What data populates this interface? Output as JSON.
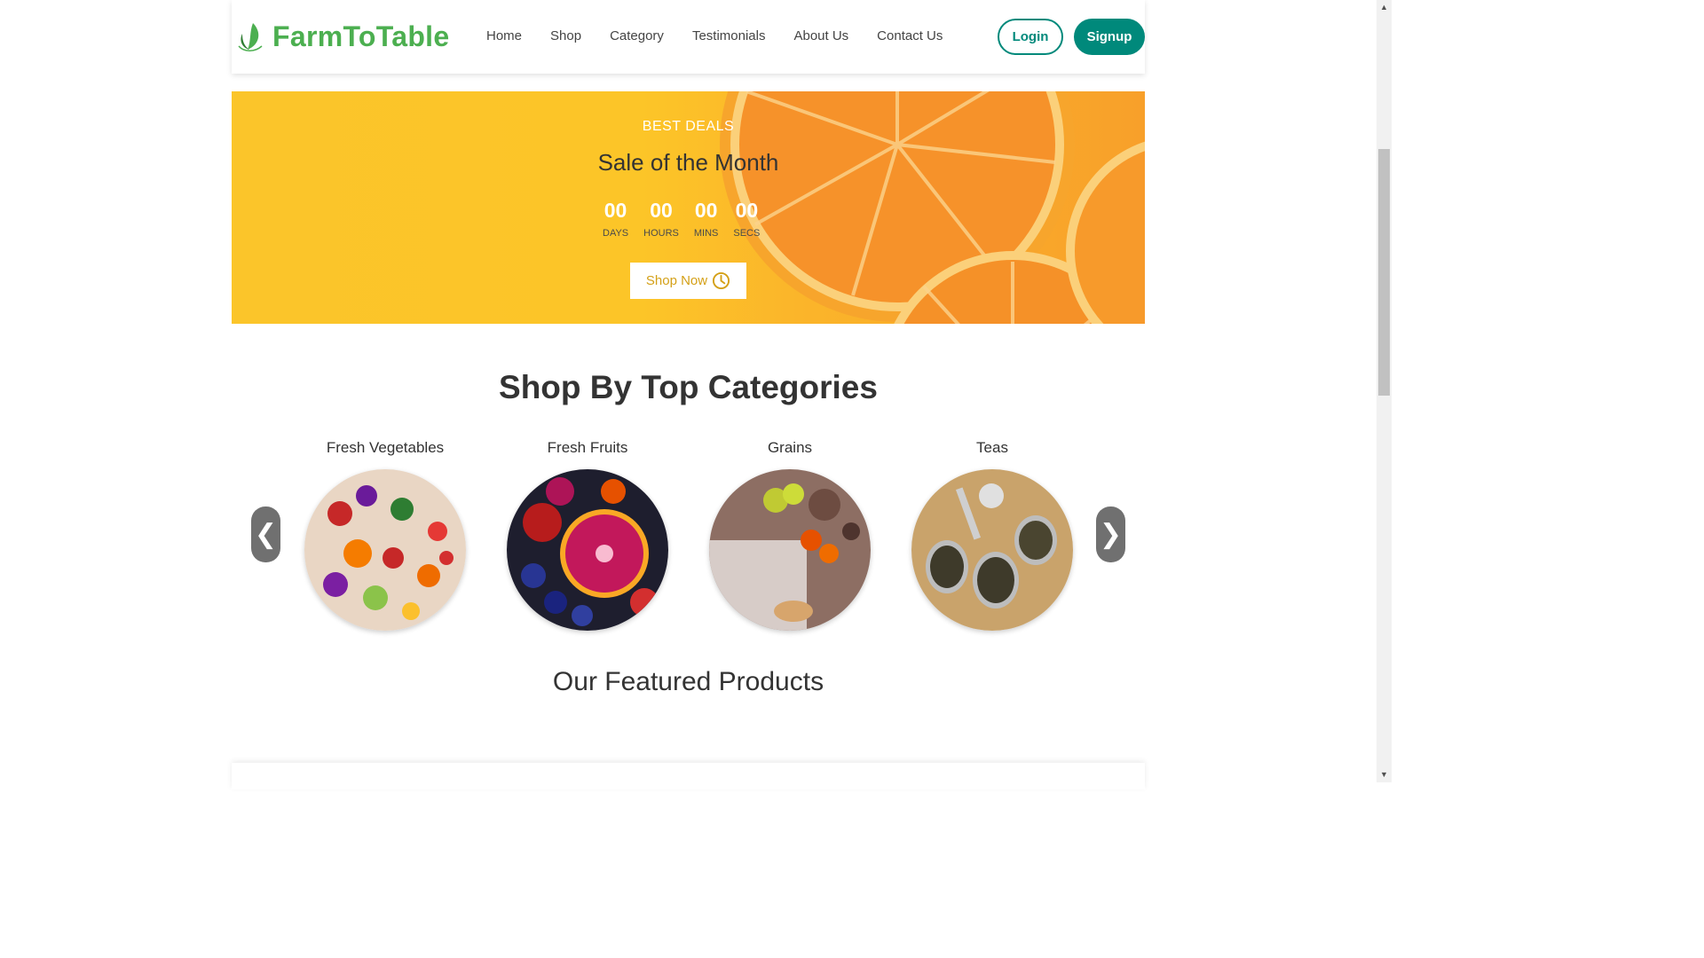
{
  "brand": {
    "name": "FarmToTable",
    "color": "#4caf50"
  },
  "nav": {
    "links": [
      "Home",
      "Shop",
      "Category",
      "Testimonials",
      "About Us",
      "Contact Us"
    ],
    "login_label": "Login",
    "signup_label": "Signup",
    "accent": "#00897b"
  },
  "hero": {
    "eyebrow": "BEST DEALS",
    "title": "Sale of the Month",
    "countdown": [
      {
        "value": "00",
        "label": "DAYS"
      },
      {
        "value": "00",
        "label": "HOURS"
      },
      {
        "value": "00",
        "label": "MINS"
      },
      {
        "value": "00",
        "label": "SECS"
      }
    ],
    "cta_label": "Shop Now",
    "cta_icon": "clock-icon",
    "background": "#fcc528"
  },
  "categories": {
    "heading": "Shop By Top Categories",
    "items": [
      {
        "label": "Fresh Vegetables"
      },
      {
        "label": "Fresh Fruits"
      },
      {
        "label": "Grains"
      },
      {
        "label": "Teas"
      }
    ],
    "prev_icon": "chevron-left-icon",
    "next_icon": "chevron-right-icon"
  },
  "featured": {
    "heading": "Our Featured Products"
  }
}
